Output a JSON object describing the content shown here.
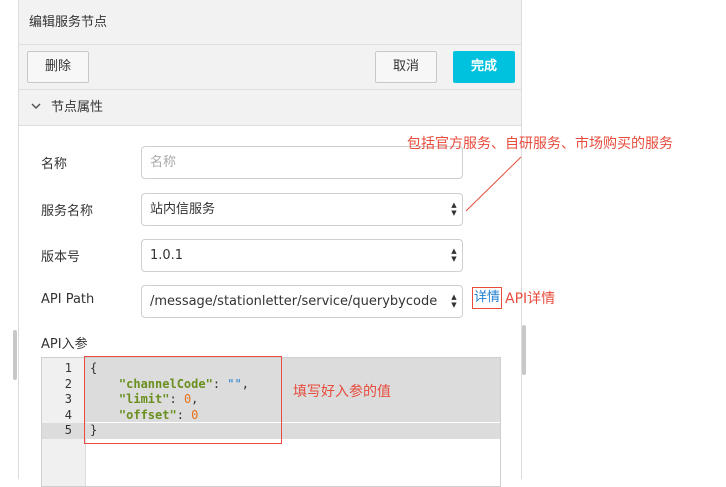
{
  "header": {
    "title": "编辑服务节点"
  },
  "toolbar": {
    "delete_label": "删除",
    "cancel_label": "取消",
    "done_label": "完成"
  },
  "section": {
    "title": "节点属性",
    "icon": "chevron-down-icon"
  },
  "form": {
    "name_label": "名称",
    "name_placeholder": "名称",
    "service_label": "服务名称",
    "service_value": "站内信服务",
    "version_label": "版本号",
    "version_value": "1.0.1",
    "api_path_label": "API Path",
    "api_path_value": "/message/stationletter/service/querybycode",
    "detail_link": "详情",
    "api_params_label": "API入参"
  },
  "editor": {
    "line_numbers": [
      "1",
      "2",
      "3",
      "4",
      "5"
    ],
    "lines": [
      {
        "plain": "{"
      },
      {
        "key": "\"channelCode\"",
        "sep": ": ",
        "val": "\"\"",
        "val_type": "str",
        "tail": ","
      },
      {
        "key": "\"limit\"",
        "sep": ": ",
        "val": "0",
        "val_type": "num",
        "tail": ","
      },
      {
        "key": "\"offset\"",
        "sep": ": ",
        "val": "0",
        "val_type": "num",
        "tail": ""
      },
      {
        "plain": "}"
      }
    ],
    "active_line": 5
  },
  "annotations": {
    "services_note": "包括官方服务、自研服务、市场购买的服务",
    "api_detail_note": "API详情",
    "params_note": "填写好入参的值"
  },
  "colors": {
    "accent": "#00c1de",
    "annotation": "#e74c3c",
    "link": "#1f7ed0"
  }
}
